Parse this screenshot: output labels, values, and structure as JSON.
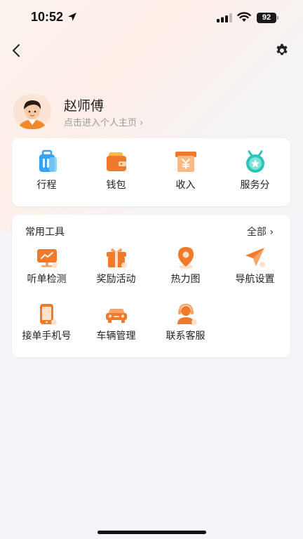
{
  "status_bar": {
    "time": "10:52",
    "battery": "92",
    "icons": [
      "location-arrow-icon",
      "signal-icon",
      "wifi-icon",
      "battery-icon"
    ]
  },
  "nav": {
    "back_icon": "chevron-left-icon",
    "settings_icon": "gear-icon"
  },
  "profile": {
    "name": "赵师傅",
    "link_text": "点击进入个人主页 ›"
  },
  "quick_actions": [
    {
      "label": "行程",
      "icon": "suitcase-icon"
    },
    {
      "label": "钱包",
      "icon": "wallet-icon"
    },
    {
      "label": "收入",
      "icon": "income-icon"
    },
    {
      "label": "服务分",
      "icon": "service-badge-icon"
    }
  ],
  "tools": {
    "title": "常用工具",
    "all_label": "全部 ›",
    "items": [
      {
        "label": "听单检测",
        "icon": "monitor-check-icon"
      },
      {
        "label": "奖励活动",
        "icon": "gift-icon"
      },
      {
        "label": "热力图",
        "icon": "map-pin-icon"
      },
      {
        "label": "导航设置",
        "icon": "paper-plane-icon"
      },
      {
        "label": "接单手机号",
        "icon": "phone-icon"
      },
      {
        "label": "车辆管理",
        "icon": "car-icon"
      },
      {
        "label": "联系客服",
        "icon": "customer-service-icon"
      }
    ]
  },
  "colors": {
    "accent_orange": "#f07a2a",
    "accent_blue": "#3aa0f0",
    "accent_teal": "#2bc3b8",
    "background": "#f3f5f8"
  }
}
